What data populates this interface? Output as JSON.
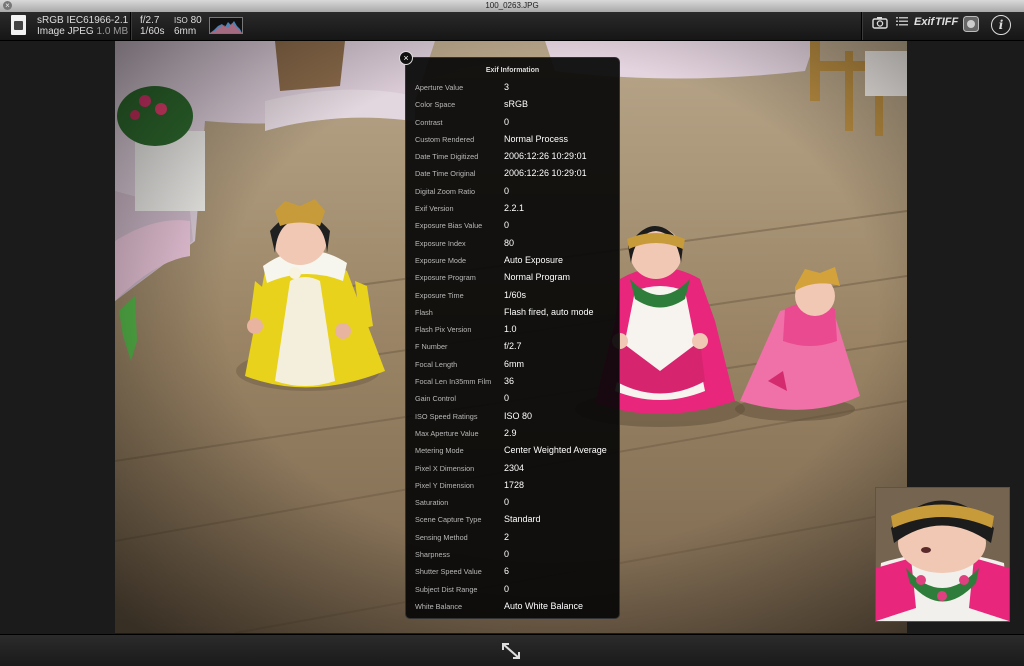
{
  "window": {
    "title": "100_0263.JPG"
  },
  "toolbar": {
    "color_profile": "sRGB IEC61966-2.1",
    "file_type": "Image JPEG",
    "file_size": "1.0 MB",
    "aperture": "f/2.7",
    "shutter": "1/60s",
    "iso_label": "ISO",
    "iso_value": "80",
    "focal": "6mm",
    "exif_label": "Exif",
    "tiff_label": "TIFF"
  },
  "exif_panel": {
    "title": "Exif Information",
    "rows": [
      {
        "key": "Aperture Value",
        "value": "3"
      },
      {
        "key": "Color Space",
        "value": "sRGB"
      },
      {
        "key": "Contrast",
        "value": "0"
      },
      {
        "key": "Custom Rendered",
        "value": "Normal Process"
      },
      {
        "key": "Date Time Digitized",
        "value": "2006:12:26 10:29:01"
      },
      {
        "key": "Date Time Original",
        "value": "2006:12:26 10:29:01"
      },
      {
        "key": "Digital Zoom Ratio",
        "value": "0"
      },
      {
        "key": "Exif Version",
        "value": "2.2.1"
      },
      {
        "key": "Exposure Bias Value",
        "value": "0"
      },
      {
        "key": "Exposure Index",
        "value": "80"
      },
      {
        "key": "Exposure Mode",
        "value": "Auto Exposure"
      },
      {
        "key": "Exposure Program",
        "value": "Normal Program"
      },
      {
        "key": "Exposure Time",
        "value": "1/60s"
      },
      {
        "key": "Flash",
        "value": "Flash fired, auto mode"
      },
      {
        "key": "Flash Pix Version",
        "value": "1.0"
      },
      {
        "key": "F Number",
        "value": "f/2.7"
      },
      {
        "key": "Focal Length",
        "value": "6mm"
      },
      {
        "key": "Focal Len In35mm Film",
        "value": "36"
      },
      {
        "key": "Gain Control",
        "value": "0"
      },
      {
        "key": "ISO Speed Ratings",
        "value": "ISO 80"
      },
      {
        "key": "Max Aperture Value",
        "value": "2.9"
      },
      {
        "key": "Metering Mode",
        "value": "Center Weighted Average"
      },
      {
        "key": "Pixel X Dimension",
        "value": "2304"
      },
      {
        "key": "Pixel Y Dimension",
        "value": "1728"
      },
      {
        "key": "Saturation",
        "value": "0"
      },
      {
        "key": "Scene Capture Type",
        "value": "Standard"
      },
      {
        "key": "Sensing Method",
        "value": "2"
      },
      {
        "key": "Sharpness",
        "value": "0"
      },
      {
        "key": "Shutter Speed Value",
        "value": "6"
      },
      {
        "key": "Subject Dist Range",
        "value": "0"
      },
      {
        "key": "White Balance",
        "value": "Auto White Balance"
      }
    ]
  },
  "icons": {
    "window_close": "close-icon",
    "file": "file-icon",
    "histogram": "histogram-icon",
    "camera": "camera-icon",
    "list": "list-icon",
    "gps": "gps-icon",
    "info": "info-icon",
    "fullscreen": "fullscreen-icon",
    "panel_close": "close-icon"
  },
  "colors": {
    "toolbar_bg": "#1e1e1e",
    "panel_bg": "#080808",
    "accent_text": "#ffffff"
  }
}
